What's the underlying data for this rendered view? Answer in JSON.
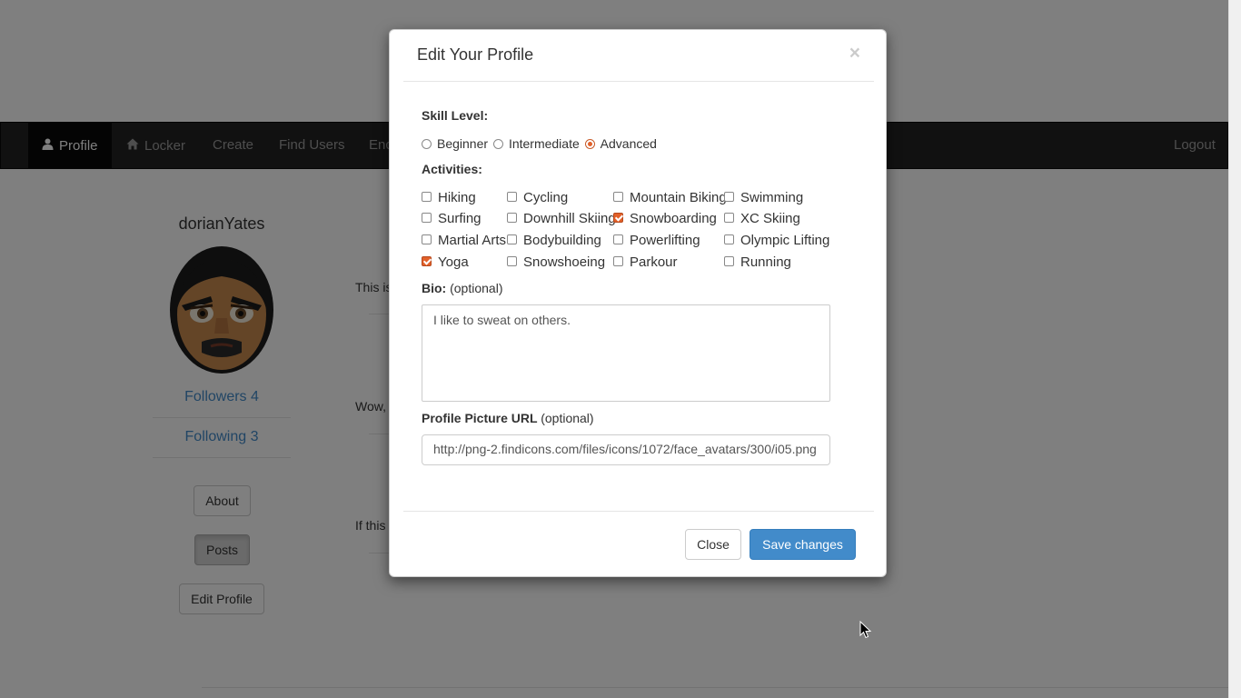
{
  "navbar": {
    "items": [
      {
        "label": "Profile",
        "icon": "user-icon"
      },
      {
        "label": "Locker",
        "icon": "home-icon"
      },
      {
        "label": "Create"
      },
      {
        "label": "Find Users"
      },
      {
        "label": "Enc"
      }
    ],
    "logout": "Logout"
  },
  "profile": {
    "username": "dorianYates",
    "followers": "Followers 4",
    "following": "Following 3",
    "buttons": {
      "about": "About",
      "posts": "Posts",
      "edit": "Edit Profile"
    }
  },
  "posts": [
    "This is",
    "Wow,",
    "If this"
  ],
  "modal": {
    "title": "Edit Your Profile",
    "close_glyph": "×",
    "skill_label": "Skill Level:",
    "skill_options": [
      {
        "label": "Beginner",
        "checked": false
      },
      {
        "label": "Intermediate",
        "checked": false
      },
      {
        "label": "Advanced",
        "checked": true
      }
    ],
    "activities_label": "Activities:",
    "activities": [
      {
        "label": "Hiking",
        "checked": false
      },
      {
        "label": "Cycling",
        "checked": false
      },
      {
        "label": "Mountain Biking",
        "checked": false
      },
      {
        "label": "Swimming",
        "checked": false
      },
      {
        "label": "Surfing",
        "checked": false
      },
      {
        "label": "Downhill Skiing",
        "checked": false
      },
      {
        "label": "Snowboarding",
        "checked": true
      },
      {
        "label": "XC Skiing",
        "checked": false
      },
      {
        "label": "Martial Arts",
        "checked": false
      },
      {
        "label": "Bodybuilding",
        "checked": false
      },
      {
        "label": "Powerlifting",
        "checked": false
      },
      {
        "label": "Olympic Lifting",
        "checked": false
      },
      {
        "label": "Yoga",
        "checked": true
      },
      {
        "label": "Snowshoeing",
        "checked": false
      },
      {
        "label": "Parkour",
        "checked": false
      },
      {
        "label": "Running",
        "checked": false
      }
    ],
    "bio_label": "Bio:",
    "bio_optional": "(optional)",
    "bio_value": "I like to sweat on others.",
    "picture_label": "Profile Picture URL",
    "picture_optional": "(optional)",
    "picture_value": "http://png-2.findicons.com/files/icons/1072/face_avatars/300/i05.png",
    "close_button": "Close",
    "save_button": "Save changes"
  },
  "colors": {
    "accent": "#428bca",
    "navbar": "#222222",
    "checked": "#e2612a"
  }
}
